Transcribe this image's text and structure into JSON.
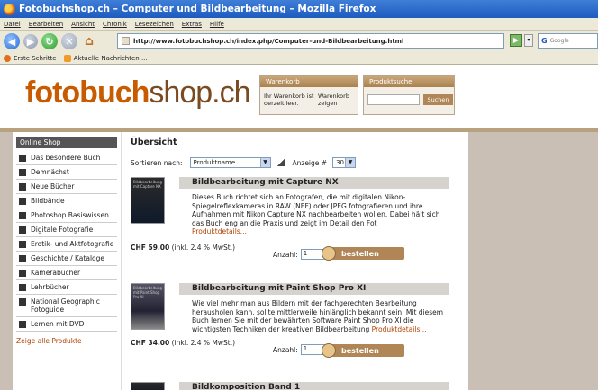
{
  "window": {
    "title": "Fotobuchshop.ch – Computer und Bildbearbeitung – Mozilla Firefox"
  },
  "menu": [
    "Datei",
    "Bearbeiten",
    "Ansicht",
    "Chronik",
    "Lesezeichen",
    "Extras",
    "Hilfe"
  ],
  "nav": {
    "url": "http://www.fotobuchshop.ch/index.php/Computer-und-Bildbearbeitung.html",
    "search_placeholder": "Google",
    "search_engine_icon": "G"
  },
  "bookmarks": [
    "Erste Schritte",
    "Aktuelle Nachrichten ..."
  ],
  "site": {
    "logo_part1": "fotobuch",
    "logo_part2": "shop.ch",
    "cart": {
      "title": "Warenkorb",
      "status": "Ihr Warenkorb ist derzeit leer.",
      "link": "Warenkorb zeigen"
    },
    "search": {
      "title": "Produktsuche",
      "button": "Suchen"
    }
  },
  "sidebar": {
    "heading": "Online Shop",
    "items": [
      "Das besondere Buch",
      "Demnächst",
      "Neue Bücher",
      "Bildbände",
      "Photoshop Basiswissen",
      "Digitale Fotografie",
      "Erotik- und Aktfotografie",
      "Geschichte / Kataloge",
      "Kamerabücher",
      "Lehrbücher",
      "National Geographic Fotoguide",
      "Lernen mit DVD"
    ],
    "footer_link": "Zeige alle Produkte"
  },
  "main": {
    "title": "Übersicht",
    "sort_label": "Sortieren nach:",
    "sort_value": "Produktname",
    "count_label": "Anzeige #",
    "count_value": "30",
    "products": [
      {
        "title": "Bildbearbeitung mit Capture NX",
        "desc": "Dieses Buch richtet sich an Fotografen, die mit digitalen Nikon-Spiegelreflexkameras in RAW (NEF) oder JPEG fotografieren und ihre Aufnahmen mit Nikon Capture NX nachbearbeiten wollen. Dabei hält sich das Buch eng an die Praxis und zeigt im Detail den Fot",
        "more": "Produktdetails...",
        "price": "CHF 59.00",
        "vat": "(inkl. 2.4 % MwSt.)",
        "qty_label": "Anzahl:",
        "qty": "1",
        "order": "bestellen",
        "cover_text": "Bildbearbeitung mit Capture NX"
      },
      {
        "title": "Bildbearbeitung mit Paint Shop Pro XI",
        "desc": "Wie viel mehr man aus Bildern mit der fachgerechten Bearbeitung herausholen kann, sollte mittlerweile hinlänglich bekannt sein. Mit diesem Buch lernen Sie mit der bewährten Software Paint Shop Pro XI die wichtigsten Techniken der kreativen Bildbearbeitung",
        "more": "Produktdetails...",
        "price": "CHF 34.00",
        "vat": "(inkl. 2.4 % MwSt.)",
        "qty_label": "Anzahl:",
        "qty": "1",
        "order": "bestellen",
        "cover_text": "Bildbearbeitung mit Paint Shop Pro XI"
      },
      {
        "title": "Bildkomposition Band 1"
      }
    ]
  }
}
